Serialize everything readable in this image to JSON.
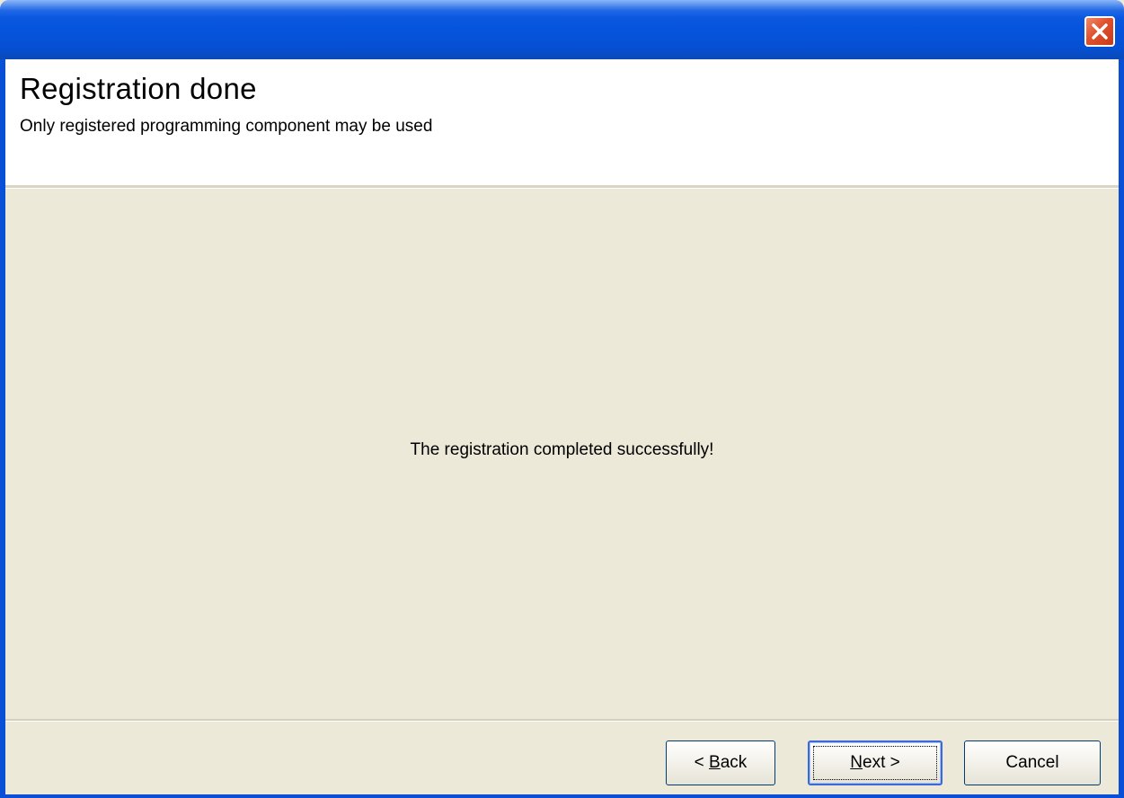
{
  "window": {
    "title": "",
    "close_icon": "close-icon"
  },
  "header": {
    "title": "Registration done",
    "subtitle": "Only registered programming component may be used"
  },
  "body": {
    "message": "The registration completed successfully!"
  },
  "buttons": {
    "back": {
      "prefix": "< ",
      "mnemonic": "B",
      "rest": "ack"
    },
    "next": {
      "mnemonic": "N",
      "rest": "ext >"
    },
    "cancel": {
      "label": "Cancel"
    }
  },
  "colors": {
    "titlebar": "#0653db",
    "close": "#e0502c",
    "body": "#ece9d8",
    "header": "#ffffff"
  }
}
